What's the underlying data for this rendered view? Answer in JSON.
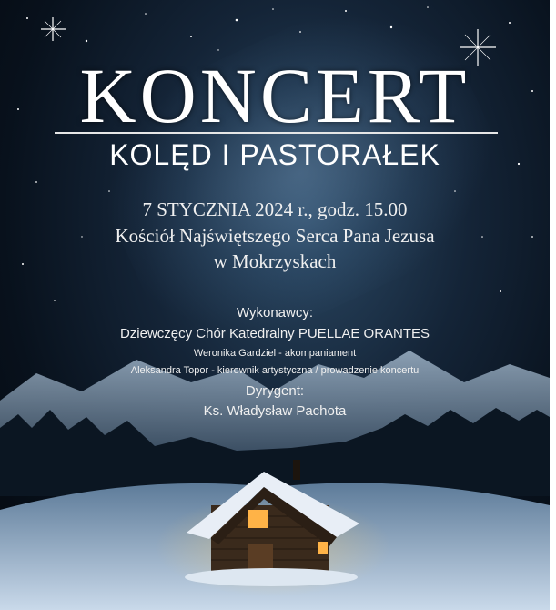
{
  "poster": {
    "title": "KONCERT",
    "subtitle": "KOLĘD I PASTORAŁEK",
    "date_line": "7 STYCZNIA 2024 r., godz. 15.00",
    "venue_line1": "Kościół Najświętszego Serca Pana Jezusa",
    "venue_line2": "w Mokrzyskach",
    "performers_label": "Wykonawcy:",
    "choir": "Dziewczęcy Chór Katedralny PUELLAE ORANTES",
    "accompanist": "Weronika Gardziel - akompaniament",
    "director": "Aleksandra Topor - kierownik artystyczna / prowadzenie koncertu",
    "conductor_label": "Dyrygent:",
    "conductor": "Ks. Władysław Pachota"
  },
  "colors": {
    "sky_dark": "#04080e",
    "sky_mid": "#142437",
    "window_light": "#ffb347",
    "snow": "#c8d8e8"
  }
}
